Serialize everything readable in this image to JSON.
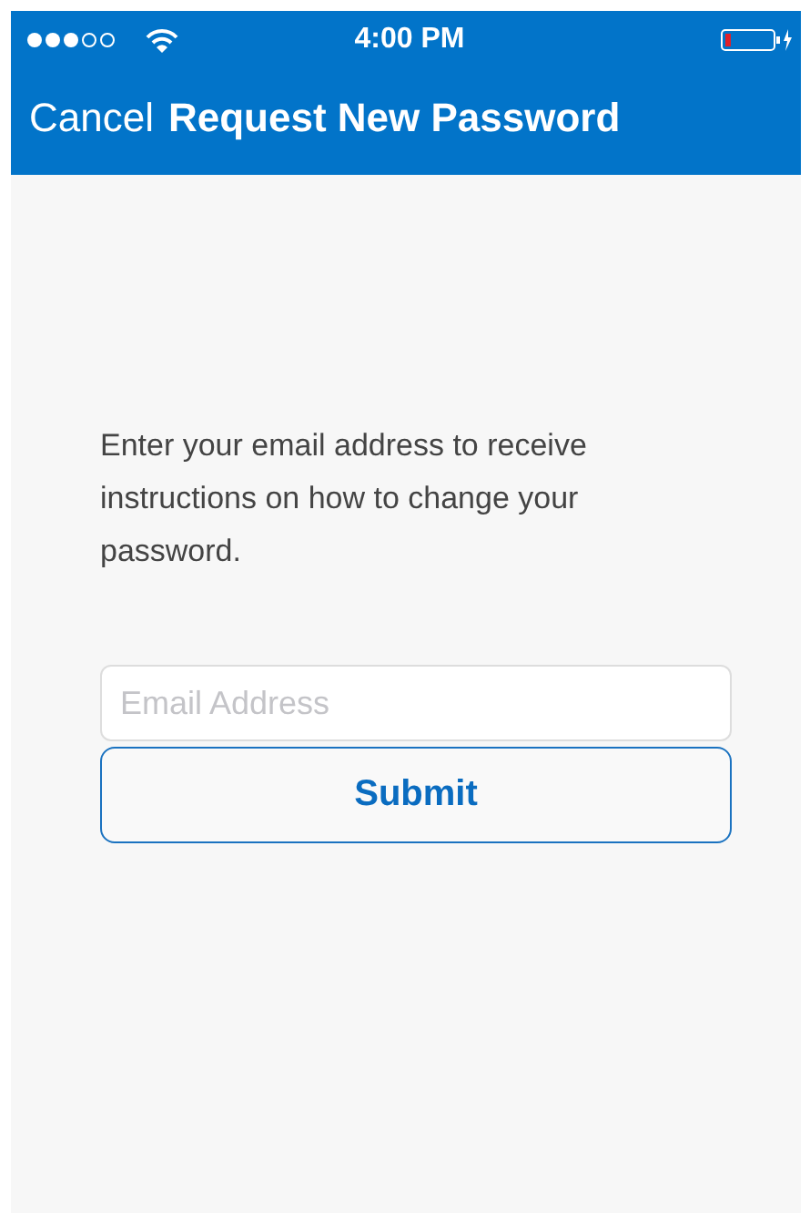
{
  "status_bar": {
    "time": "4:00 PM"
  },
  "nav_bar": {
    "cancel": "Cancel",
    "title": "Request New Password"
  },
  "instructions": "Enter your email address to receive instructions on how to change your password.",
  "email_field": {
    "placeholder": "Email Address"
  },
  "submit_button": {
    "label": "Submit"
  }
}
